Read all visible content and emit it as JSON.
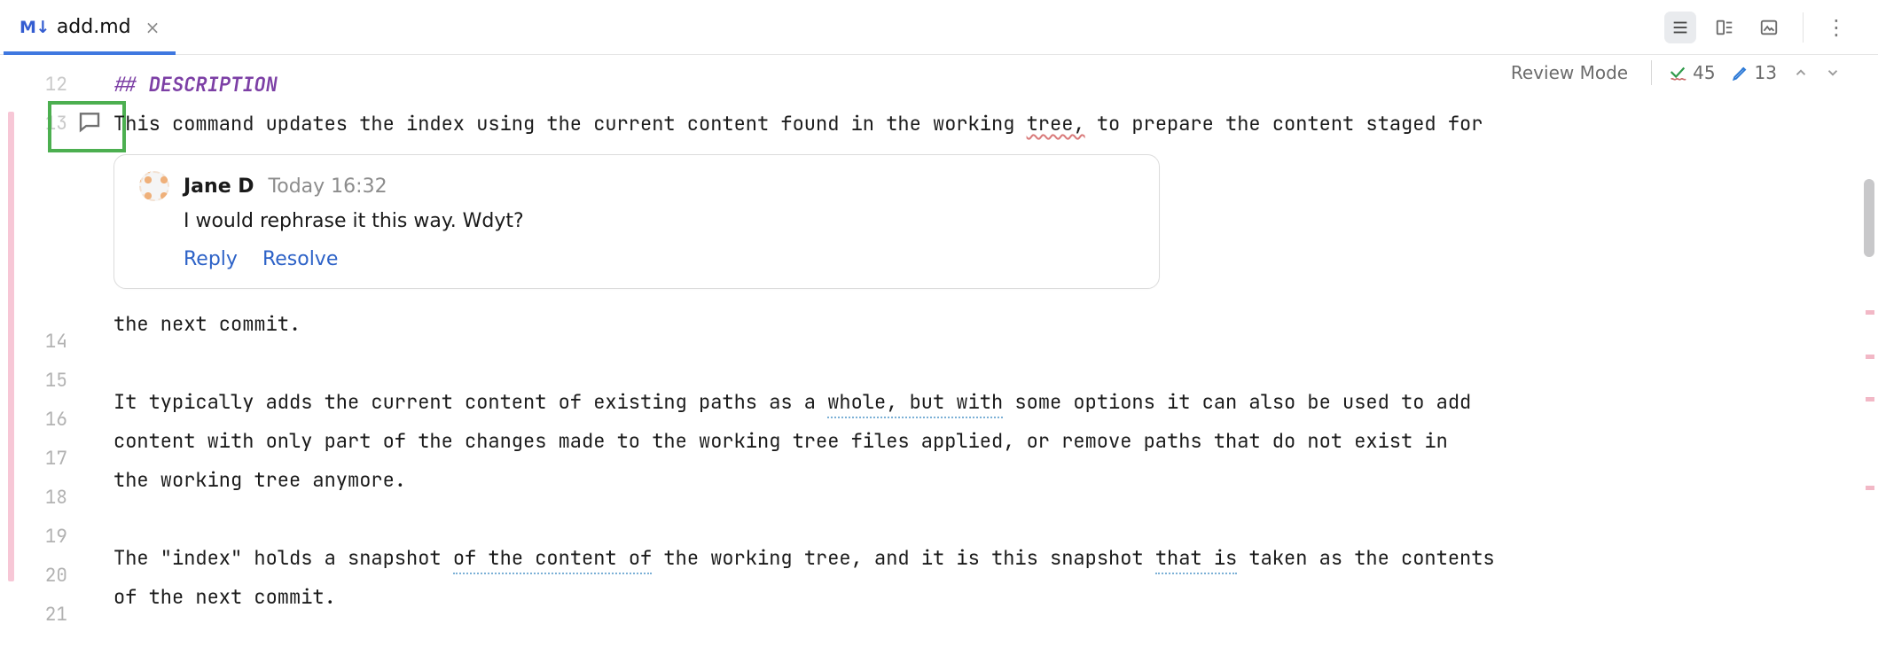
{
  "tab": {
    "badge": "M↓",
    "filename": "add.md"
  },
  "status": {
    "mode_label": "Review Mode",
    "warnings_count": "45",
    "edits_count": "13"
  },
  "gutter": {
    "lines": [
      "12",
      "13",
      "14",
      "15",
      "16",
      "17",
      "18",
      "19",
      "20",
      "21"
    ]
  },
  "code": {
    "l12_hash": "## ",
    "l12_title": "DESCRIPTION",
    "l13_a": "This command updates the index using the current content found in the working ",
    "l13_b": "tree,",
    "l13_c": " to prepare the content staged for",
    "l14": "the next commit.",
    "l15": "",
    "l16_a": "It typically adds the current content of existing paths as a ",
    "l16_b": "whole, but with",
    "l16_c": " some options it can also be used to add",
    "l17": "content with only part of the changes made to the working tree files applied, or remove paths that do not exist in",
    "l18": "the working tree anymore.",
    "l19": "",
    "l20_a": "The \"index\" holds a snapshot ",
    "l20_b": "of the content of",
    "l20_c": " the working tree, and it is this snapshot ",
    "l20_d": "that is",
    "l20_e": " taken as the contents",
    "l21": "of the next commit."
  },
  "comment": {
    "author": "Jane D",
    "timestamp": "Today 16:32",
    "body": "I would rephrase it this way. Wdyt?",
    "reply_label": "Reply",
    "resolve_label": "Resolve"
  },
  "minimap_dots": [
    280,
    330,
    378,
    478
  ]
}
